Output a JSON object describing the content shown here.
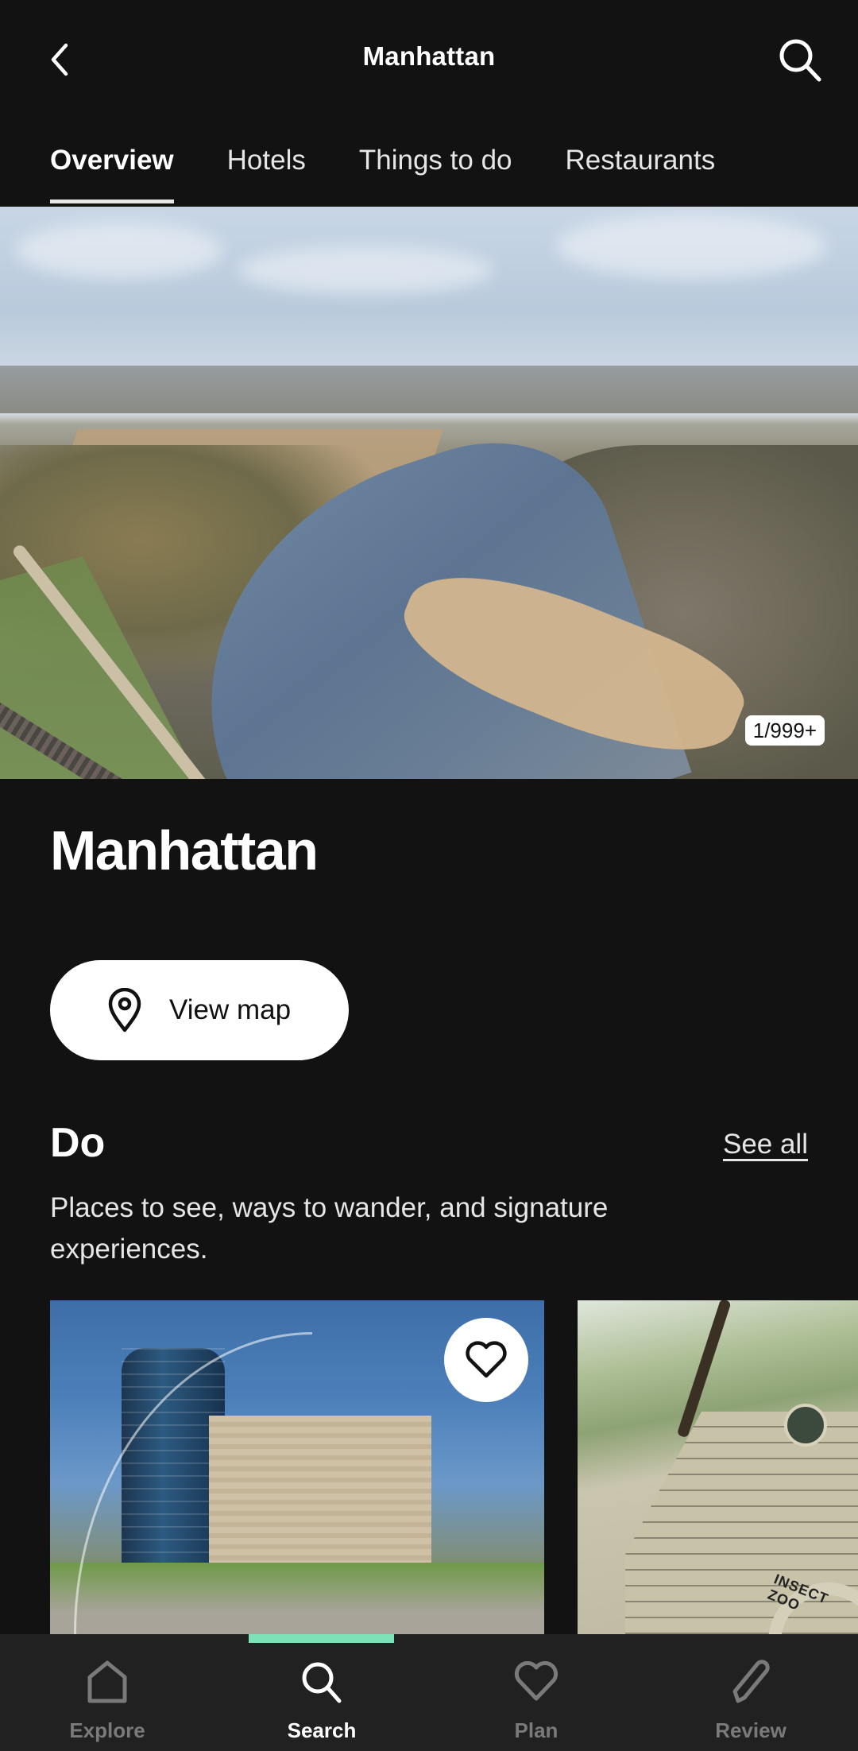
{
  "header": {
    "title": "Manhattan",
    "back_icon": "chevron-left-icon",
    "search_icon": "search-icon"
  },
  "tabs": [
    {
      "label": "Overview",
      "active": true
    },
    {
      "label": "Hotels",
      "active": false
    },
    {
      "label": "Things to do",
      "active": false
    },
    {
      "label": "Restaurants",
      "active": false
    }
  ],
  "hero": {
    "photo_counter": "1/999+",
    "description": "Aerial view of a river winding through autumn trees and farmland"
  },
  "place": {
    "title": "Manhattan",
    "view_map_label": "View map",
    "view_map_icon": "map-pin-icon"
  },
  "do_section": {
    "title": "Do",
    "see_all_label": "See all",
    "description": "Places to see, ways to wander, and signature experiences.",
    "cards": [
      {
        "image": "Museum building with glass tower and fountains",
        "saved": false,
        "heart_icon": "heart-outline-icon"
      },
      {
        "image": "Stone building with Insect Zoo sign",
        "sign_text": "INSECT ZOO"
      }
    ]
  },
  "bottom_nav": {
    "accent_color": "#7ee2b8",
    "items": [
      {
        "label": "Explore",
        "icon": "home-icon",
        "active": false
      },
      {
        "label": "Search",
        "icon": "search-icon",
        "active": true
      },
      {
        "label": "Plan",
        "icon": "heart-icon",
        "active": false
      },
      {
        "label": "Review",
        "icon": "pencil-icon",
        "active": false
      }
    ]
  }
}
